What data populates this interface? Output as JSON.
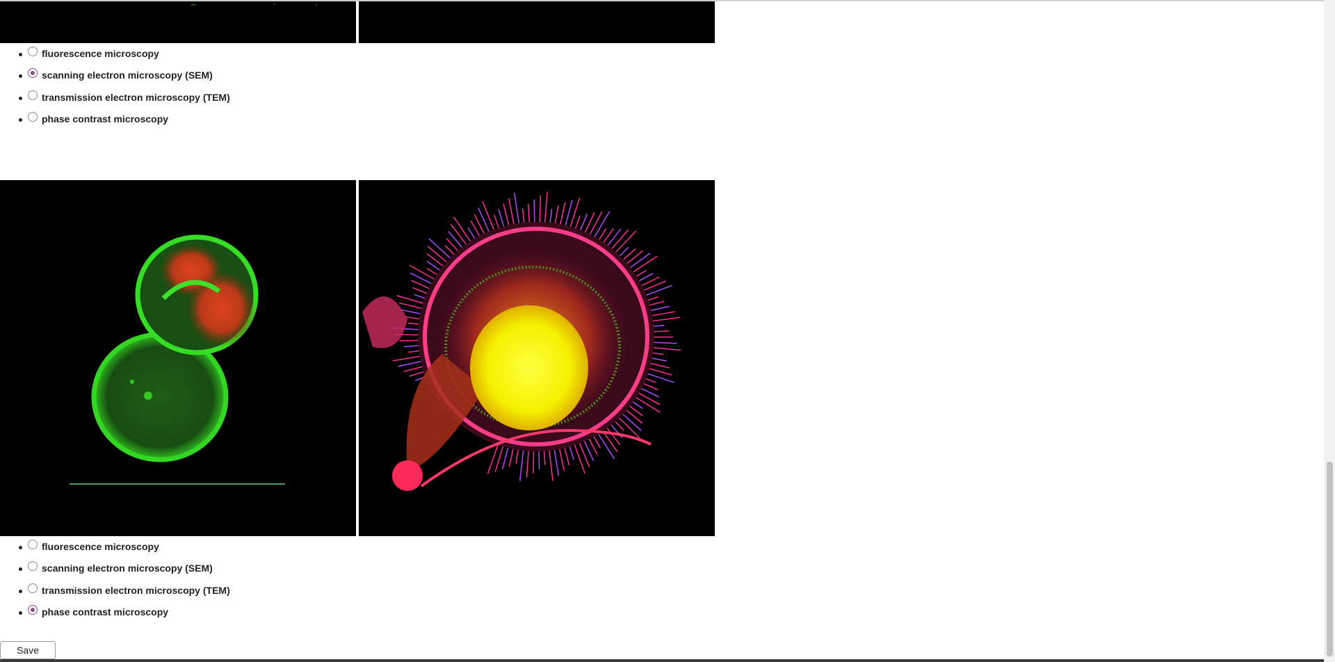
{
  "question_1": {
    "options": [
      {
        "label": "fluorescence microscopy",
        "selected": false
      },
      {
        "label": "scanning electron microscopy (SEM)",
        "selected": true
      },
      {
        "label": "transmission electron microscopy (TEM)",
        "selected": false
      },
      {
        "label": "phase contrast microscopy",
        "selected": false
      }
    ]
  },
  "question_2": {
    "options": [
      {
        "label": "fluorescence microscopy",
        "selected": false
      },
      {
        "label": "scanning electron microscopy (SEM)",
        "selected": false
      },
      {
        "label": "transmission electron microscopy (TEM)",
        "selected": false
      },
      {
        "label": "phase contrast microscopy",
        "selected": true
      }
    ]
  },
  "images": {
    "left": "fluorescent-cells-green-red",
    "right": "fluorescent-cell-yellow-magenta-filopodia"
  },
  "colors": {
    "radio_accent": "#8e4c8e",
    "panel_background": "#000000"
  },
  "save_label": "Save"
}
